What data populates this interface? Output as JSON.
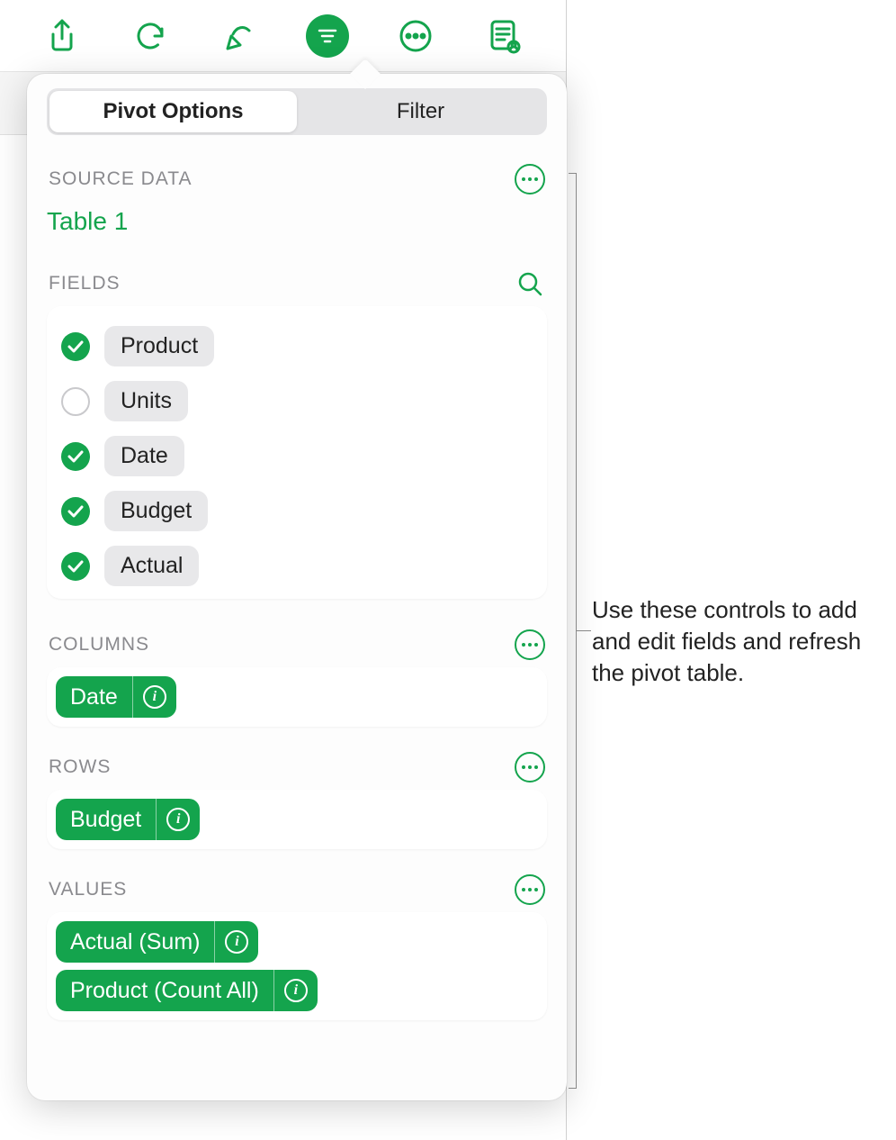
{
  "colors": {
    "accent": "#14a44d"
  },
  "toolbar": {
    "icons": [
      "share-icon",
      "undo-icon",
      "format-icon",
      "organize-icon",
      "more-icon",
      "collaborate-icon"
    ],
    "active_index": 3
  },
  "popover": {
    "tabs": {
      "active": "Pivot Options",
      "items": [
        "Pivot Options",
        "Filter"
      ]
    },
    "source": {
      "label": "SOURCE DATA",
      "name": "Table 1"
    },
    "fields": {
      "label": "FIELDS",
      "items": [
        {
          "name": "Product",
          "checked": true
        },
        {
          "name": "Units",
          "checked": false
        },
        {
          "name": "Date",
          "checked": true
        },
        {
          "name": "Budget",
          "checked": true
        },
        {
          "name": "Actual",
          "checked": true
        }
      ]
    },
    "columns": {
      "label": "COLUMNS",
      "chips": [
        {
          "label": "Date"
        }
      ]
    },
    "rows": {
      "label": "ROWS",
      "chips": [
        {
          "label": "Budget"
        }
      ]
    },
    "values": {
      "label": "VALUES",
      "chips": [
        {
          "label": "Actual (Sum)"
        },
        {
          "label": "Product (Count All)"
        }
      ]
    }
  },
  "callout": {
    "text": "Use these controls to add and edit fields and refresh the pivot table."
  }
}
